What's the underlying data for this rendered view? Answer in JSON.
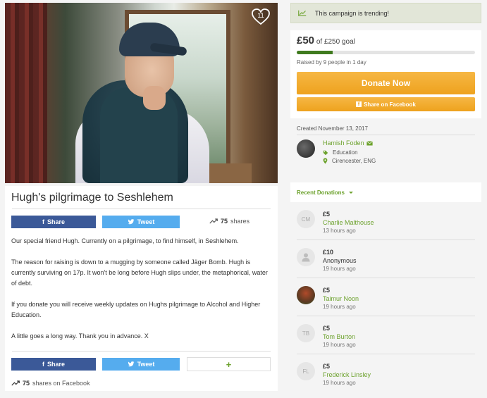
{
  "campaign": {
    "title": "Hugh's pilgrimage to Seshlehem",
    "hearts": "11",
    "share_label": "Share",
    "tweet_label": "Tweet",
    "share_count": "75",
    "shares_label": "shares",
    "shares_on_facebook": "shares on Facebook",
    "description": [
      "Our special friend Hugh. Currently on a pilgrimage, to find himself, in Seshlehem.",
      "The reason for raising is down to a mugging by someone called Jäger Bomb. Hugh is currently surviving on 17p. It won't be long before Hugh slips under, the metaphorical, water of debt.",
      "If you donate you will receive weekly updates on Hughs pilgrimage to Alcohol and Higher Education.",
      "A little goes a long way. Thank you in advance. X"
    ],
    "plus_label": "+"
  },
  "sidebar": {
    "trending": "This campaign is trending!",
    "raised": "£50",
    "goal": "of £250 goal",
    "progress": 0.2,
    "raised_by": "Raised by 9 people in 1 day",
    "donate_label": "Donate Now",
    "share_fb_label": "Share on Facebook",
    "created": "Created November 13, 2017",
    "organizer": {
      "name": "Hamish Foden",
      "category": "Education",
      "location": "Cirencester, ENG"
    },
    "recent_label": "Recent Donations"
  },
  "donations": [
    {
      "initials": "CM",
      "amount": "£5",
      "name": "Charlie Malthouse",
      "time": "13 hours ago"
    },
    {
      "initials": "",
      "amount": "£10",
      "name": "Anonymous",
      "time": "19 hours ago"
    },
    {
      "initials": "",
      "amount": "£5",
      "name": "Taimur Noon",
      "time": "19 hours ago"
    },
    {
      "initials": "TB",
      "amount": "£5",
      "name": "Tom Burton",
      "time": "19 hours ago"
    },
    {
      "initials": "FL",
      "amount": "£5",
      "name": "Frederick Linsley",
      "time": "19 hours ago"
    }
  ],
  "colors": {
    "accent_green": "#6da22e",
    "donate_orange": "#eea21e",
    "facebook": "#3b5998",
    "twitter": "#55acee"
  }
}
